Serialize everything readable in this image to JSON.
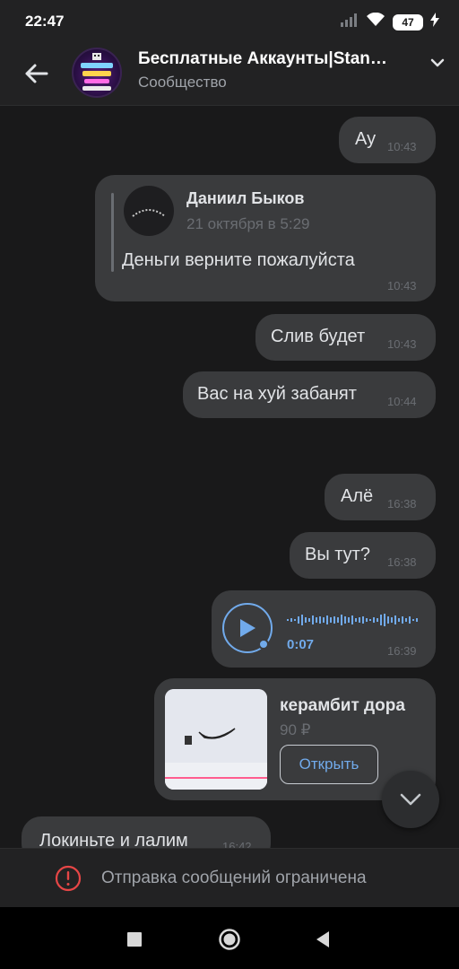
{
  "status_bar": {
    "time": "22:47",
    "battery": "47"
  },
  "header": {
    "title": "Бесплатные Аккаунты|Stan…",
    "subtitle": "Сообщество"
  },
  "messages": [
    {
      "text": "Ау",
      "time": "10:43"
    },
    {
      "quote": {
        "author": "Даниил Быков",
        "date": "21 октября в 5:29"
      },
      "text": "Деньги верните пожалуйста",
      "time": "10:43"
    },
    {
      "text": "Слив будет",
      "time": "10:43"
    },
    {
      "text": "Вас на хуй забанят",
      "time": "10:44"
    },
    {
      "text": "Алё",
      "time": "16:38"
    },
    {
      "text": "Вы тут?",
      "time": "16:38"
    },
    {
      "voice_duration": "0:07",
      "time": "16:39"
    },
    {
      "product": {
        "title": "керамбит дора",
        "price": "90 ₽",
        "button": "Открыть"
      }
    },
    {
      "text": "Локиньте и лалим",
      "time": "16:42"
    }
  ],
  "restriction_notice": "Отправка сообщений ограничена",
  "colors": {
    "accent": "#71aaeb",
    "bubble": "#3a3b3d",
    "background": "#19191a",
    "error": "#e64646"
  }
}
